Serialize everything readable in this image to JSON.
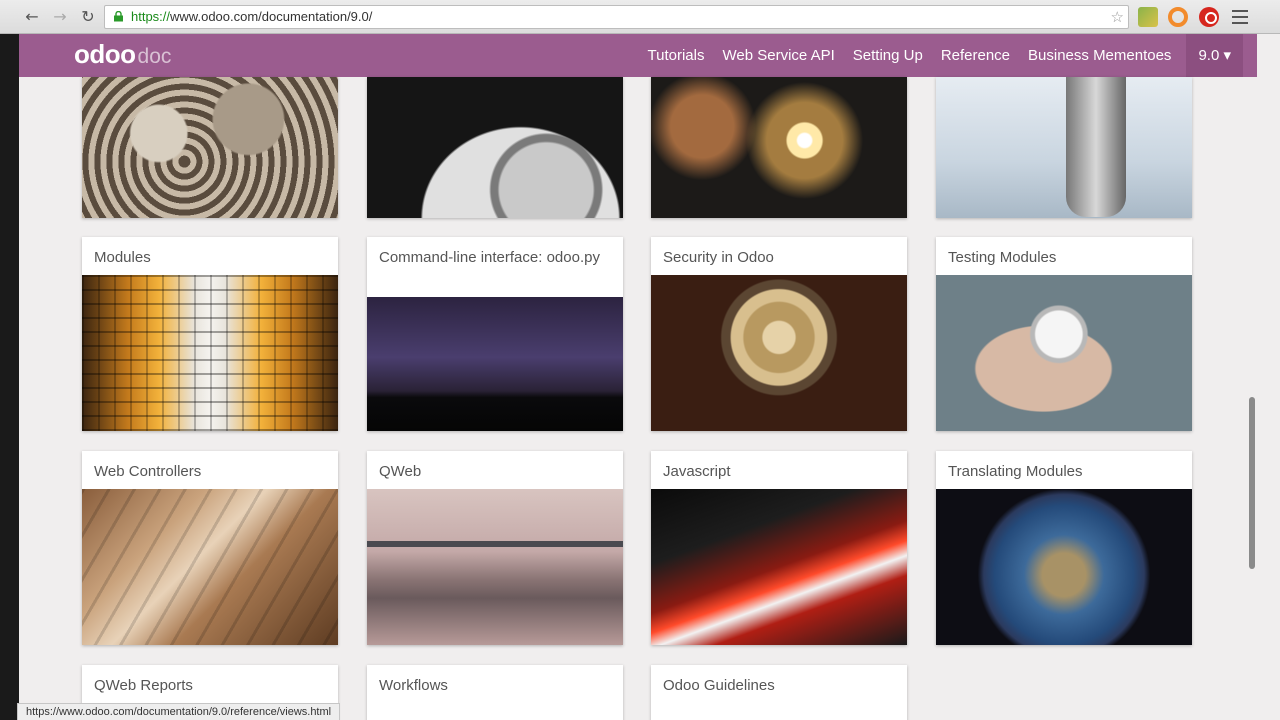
{
  "browser": {
    "url_scheme": "https://",
    "url_rest": "www.odoo.com/documentation/9.0/",
    "status_url": "https://www.odoo.com/documentation/9.0/reference/views.html"
  },
  "header": {
    "logo_main": "odoo",
    "logo_sub": "doc",
    "nav": [
      {
        "label": "Tutorials"
      },
      {
        "label": "Web Service API"
      },
      {
        "label": "Setting Up"
      },
      {
        "label": "Reference"
      },
      {
        "label": "Business Mementoes"
      }
    ],
    "version_label": "9.0 ▾"
  },
  "cards_row1": [
    {
      "image": "gears"
    },
    {
      "image": "hard-drive"
    },
    {
      "image": "sparkler"
    },
    {
      "image": "binoculars"
    }
  ],
  "cards": [
    {
      "title": "Modules",
      "image": "buildings"
    },
    {
      "title": "Command-line interface: odoo.py",
      "image": "lightning"
    },
    {
      "title": "Security in Odoo",
      "image": "lock"
    },
    {
      "title": "Testing Modules",
      "image": "stopwatch"
    },
    {
      "title": "Web Controllers",
      "image": "wooden-gears"
    },
    {
      "title": "QWeb",
      "image": "bridge"
    },
    {
      "title": "Javascript",
      "image": "traffic-lights"
    },
    {
      "title": "Translating Modules",
      "image": "earth"
    },
    {
      "title": "QWeb Reports",
      "image": ""
    },
    {
      "title": "Workflows",
      "image": ""
    },
    {
      "title": "Odoo Guidelines",
      "image": ""
    }
  ],
  "colors": {
    "brand": "#9b5c8f",
    "page_bg": "#f0eeee"
  }
}
